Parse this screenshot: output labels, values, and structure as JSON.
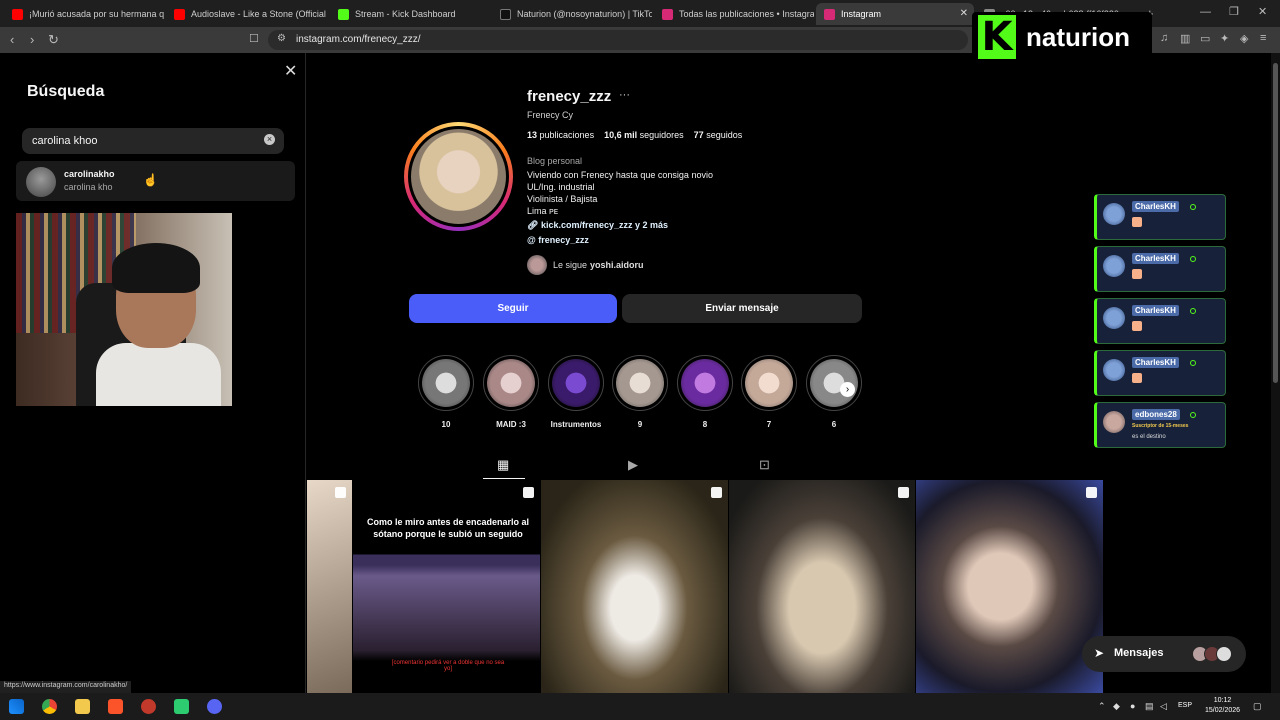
{
  "browser": {
    "tabs": [
      {
        "title": "¡Murió acusada por su hermana que",
        "color": "#ff0000"
      },
      {
        "title": "Audioslave - Like a Stone (Official Vi",
        "color": "#ff0000"
      },
      {
        "title": "Stream - Kick Dashboard",
        "color": "#53fc18"
      },
      {
        "title": "Naturion (@nosoynaturion) | TikTok",
        "color": "#111111"
      },
      {
        "title": "Todas las publicaciones • Instagram",
        "color": "#d62976"
      },
      {
        "title": "Instagram",
        "color": "#d62976"
      },
      {
        "title": "c00-c13e-46ce-b628-ff16f320",
        "color": "#888888"
      }
    ],
    "url": "instagram.com/frenecy_zzz/",
    "status_url": "https://www.instagram.com/carolinakho/"
  },
  "overlay": {
    "logo_letter": "K",
    "channel_name": "naturion"
  },
  "search": {
    "title": "Búsqueda",
    "query": "carolina khoo",
    "results": [
      {
        "username": "carolinakho",
        "name": "carolina kho"
      }
    ]
  },
  "profile": {
    "username": "frenecy_zzz",
    "full_name": "Frenecy Cy",
    "stats": {
      "posts_count": "13",
      "posts_label": "publicaciones",
      "followers_count": "10,6 mil",
      "followers_label": "seguidores",
      "following_count": "77",
      "following_label": "seguidos"
    },
    "category": "Blog personal",
    "bio": [
      "Viviendo con Frenecy hasta que consiga novio",
      "UL/Ing. industrial",
      "Violinista / Bajista",
      "Lima ᴘᴇ"
    ],
    "link": "kick.com/frenecy_zzz y 2 más",
    "threads": "frenecy_zzz",
    "followed_by_prefix": "Le sigue",
    "followed_by_user": "yoshi.aidoru",
    "follow_button": "Seguir",
    "message_button": "Enviar mensaje"
  },
  "highlights": [
    {
      "label": "10",
      "color": "#8a8a8a"
    },
    {
      "label": "MAID :3",
      "color": "#b59a9a"
    },
    {
      "label": "Instrumentos",
      "color": "#4b2a7a"
    },
    {
      "label": "9",
      "color": "#c9b8b0"
    },
    {
      "label": "8",
      "color": "#7a3aa8"
    },
    {
      "label": "7",
      "color": "#d8c2b0"
    },
    {
      "label": "6",
      "color": "#9a9a9a"
    }
  ],
  "post": {
    "caption": "Como le miro antes de encadenarlo al sótano porque le subió un seguido",
    "red_caption": "[comentario pedirá ver a doble que no sea yo]"
  },
  "chat": [
    {
      "user": "CharlesKH",
      "sub": "",
      "msg": ""
    },
    {
      "user": "CharlesKH",
      "sub": "",
      "msg": ""
    },
    {
      "user": "CharlesKH",
      "sub": "",
      "msg": ""
    },
    {
      "user": "CharlesKH",
      "sub": "",
      "msg": ""
    },
    {
      "user": "edbones28",
      "sub": "Suscriptor de 15-meses",
      "msg": "es el destino"
    }
  ],
  "messages": {
    "label": "Mensajes"
  },
  "taskbar": {
    "lang": "ESP",
    "time": "10:12",
    "date": "15/02/2026"
  },
  "colors": {
    "follow_button": "#4a5df9",
    "kick_green": "#53fc18"
  }
}
